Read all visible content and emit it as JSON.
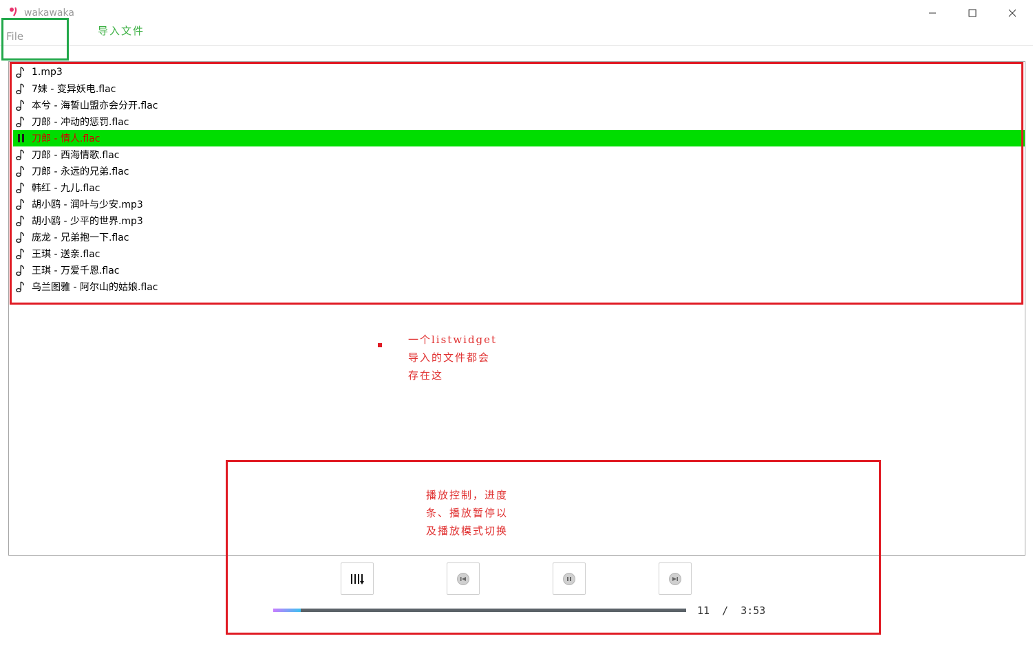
{
  "window": {
    "title": "wakawaka",
    "icon": "app-logo-icon",
    "controls": [
      "minimize-icon",
      "maximize-icon",
      "close-icon"
    ]
  },
  "menu": {
    "file_label": "File",
    "import_label": "导入文件"
  },
  "playlist": {
    "items": [
      {
        "name": "1.mp3",
        "playing": false
      },
      {
        "name": "7妹 - 变异妖电.flac",
        "playing": false
      },
      {
        "name": "本兮 - 海誓山盟亦会分开.flac",
        "playing": false
      },
      {
        "name": "刀郎 - 冲动的惩罚.flac",
        "playing": false
      },
      {
        "name": "刀郎 - 情人.flac",
        "playing": true
      },
      {
        "name": "刀郎 - 西海情歌.flac",
        "playing": false
      },
      {
        "name": "刀郎 - 永远的兄弟.flac",
        "playing": false
      },
      {
        "name": "韩红 - 九儿.flac",
        "playing": false
      },
      {
        "name": "胡小鸥 - 润叶与少安.mp3",
        "playing": false
      },
      {
        "name": "胡小鸥 - 少平的世界.mp3",
        "playing": false
      },
      {
        "name": "庞龙 - 兄弟抱一下.flac",
        "playing": false
      },
      {
        "name": "王琪 - 送亲.flac",
        "playing": false
      },
      {
        "name": "王琪 - 万爱千恩.flac",
        "playing": false
      },
      {
        "name": "乌兰图雅 - 阿尔山的姑娘.flac",
        "playing": false
      }
    ],
    "active_bg": "#00dd00",
    "active_fg": "#d40000"
  },
  "annotations": {
    "list_note": [
      "一个listwidget",
      "导入的文件都会",
      "存在这"
    ],
    "player_note": [
      "播放控制，进度",
      "条、播放暂停以",
      "及播放模式切换"
    ],
    "box_color": "#e01b24",
    "menu_box_color": "#22a84a"
  },
  "player": {
    "buttons": [
      "play-mode-icon",
      "previous-icon",
      "pause-icon",
      "next-icon"
    ],
    "progress": 0.067,
    "current_time": "11",
    "separator": "/",
    "total_time": "3:53"
  }
}
